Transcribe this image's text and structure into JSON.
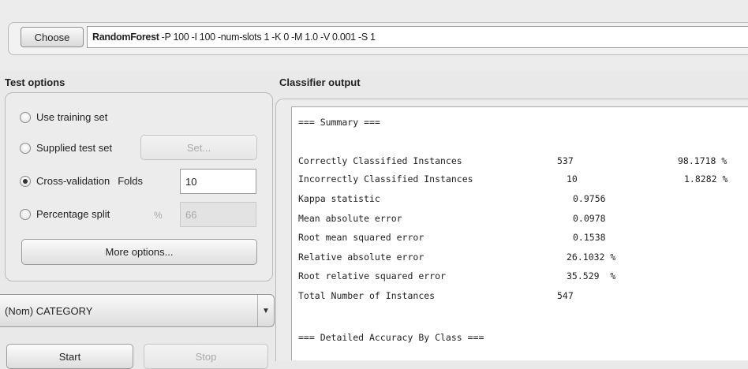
{
  "classifier": {
    "choose_label": "Choose",
    "name": "RandomForest",
    "options": "-P 100 -I 100 -num-slots 1 -K 0 -M 1.0 -V 0.001 -S 1"
  },
  "test_options": {
    "title": "Test options",
    "use_training_set": "Use training set",
    "supplied_test_set": "Supplied test set",
    "set_button": "Set...",
    "cross_validation": "Cross-validation",
    "folds_label": "Folds",
    "folds_value": "10",
    "percentage_split": "Percentage split",
    "percent_symbol": "%",
    "percentage_value": "66",
    "selected": "cross_validation",
    "more_options": "More options..."
  },
  "class_attribute": {
    "value": "(Nom) CATEGORY"
  },
  "actions": {
    "start": "Start",
    "stop": "Stop"
  },
  "output": {
    "title": "Classifier output",
    "summary_header": "=== Summary ===",
    "rows": [
      {
        "label": "Correctly Classified Instances",
        "value": "537",
        "percent": "98.1718 %"
      },
      {
        "label": "Incorrectly Classified Instances",
        "value": "10",
        "percent": "1.8282 %"
      },
      {
        "label": "Kappa statistic",
        "value": "0.9756",
        "percent": ""
      },
      {
        "label": "Mean absolute error",
        "value": "0.0978",
        "percent": ""
      },
      {
        "label": "Root mean squared error",
        "value": "0.1538",
        "percent": ""
      },
      {
        "label": "Relative absolute error",
        "value": "26.1032 %",
        "percent": ""
      },
      {
        "label": "Root relative squared error",
        "value": "35.529  %",
        "percent": ""
      },
      {
        "label": "Total Number of Instances",
        "value": "547",
        "percent": ""
      }
    ],
    "detailed_header": "=== Detailed Accuracy By Class ==="
  }
}
